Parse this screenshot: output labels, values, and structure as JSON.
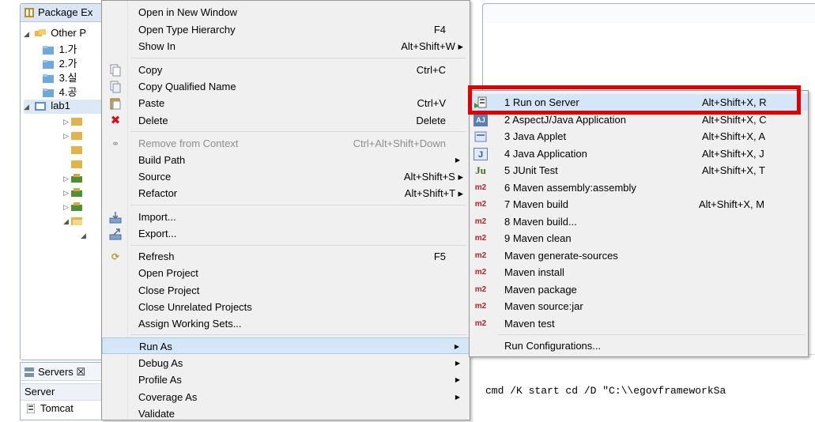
{
  "package_explorer": {
    "title": "Package Ex",
    "tree": [
      {
        "label": "Other P",
        "indent": 0
      },
      {
        "label": "1.가",
        "indent": 1
      },
      {
        "label": "2.가",
        "indent": 1
      },
      {
        "label": "3.실",
        "indent": 1
      },
      {
        "label": "4.공",
        "indent": 1
      },
      {
        "label": "lab1",
        "indent": 0
      }
    ]
  },
  "servers": {
    "title": "Servers",
    "tab_suffix": "☒",
    "column": "Server",
    "row": "Tomcat"
  },
  "context_menu": {
    "items": [
      {
        "label": "Open in New Window",
        "shortcut": ""
      },
      {
        "label": "Open Type Hierarchy",
        "shortcut": "F4"
      },
      {
        "label": "Show In",
        "shortcut": "Alt+Shift+W ▸"
      },
      {
        "label": "Copy",
        "shortcut": "Ctrl+C"
      },
      {
        "label": "Copy Qualified Name",
        "shortcut": ""
      },
      {
        "label": "Paste",
        "shortcut": "Ctrl+V"
      },
      {
        "label": "Delete",
        "shortcut": "Delete"
      },
      {
        "label": "Remove from Context",
        "shortcut": "Ctrl+Alt+Shift+Down"
      },
      {
        "label": "Build Path",
        "shortcut": ""
      },
      {
        "label": "Source",
        "shortcut": "Alt+Shift+S ▸"
      },
      {
        "label": "Refactor",
        "shortcut": "Alt+Shift+T ▸"
      },
      {
        "label": "Import...",
        "shortcut": ""
      },
      {
        "label": "Export...",
        "shortcut": ""
      },
      {
        "label": "Refresh",
        "shortcut": "F5"
      },
      {
        "label": "Open Project",
        "shortcut": ""
      },
      {
        "label": "Close Project",
        "shortcut": ""
      },
      {
        "label": "Close Unrelated Projects",
        "shortcut": ""
      },
      {
        "label": "Assign Working Sets...",
        "shortcut": ""
      },
      {
        "label": "Run As",
        "shortcut": ""
      },
      {
        "label": "Debug As",
        "shortcut": ""
      },
      {
        "label": "Profile As",
        "shortcut": ""
      },
      {
        "label": "Coverage As",
        "shortcut": ""
      },
      {
        "label": "Validate",
        "shortcut": ""
      }
    ]
  },
  "run_as_submenu": {
    "items": [
      {
        "icon": "",
        "label": "1 Run on Server",
        "shortcut": "Alt+Shift+X, R"
      },
      {
        "icon": "AJ",
        "label": "2 AspectJ/Java Application",
        "shortcut": "Alt+Shift+X, C"
      },
      {
        "icon": "",
        "label": "3 Java Applet",
        "shortcut": "Alt+Shift+X, A"
      },
      {
        "icon": "J",
        "label": "4 Java Application",
        "shortcut": "Alt+Shift+X, J"
      },
      {
        "icon": "Ju",
        "label": "5 JUnit Test",
        "shortcut": "Alt+Shift+X, T"
      },
      {
        "icon": "m2",
        "label": "6 Maven assembly:assembly",
        "shortcut": ""
      },
      {
        "icon": "m2",
        "label": "7 Maven build",
        "shortcut": "Alt+Shift+X, M"
      },
      {
        "icon": "m2",
        "label": "8 Maven build...",
        "shortcut": ""
      },
      {
        "icon": "m2",
        "label": "9 Maven clean",
        "shortcut": ""
      },
      {
        "icon": "m2",
        "label": "Maven generate-sources",
        "shortcut": ""
      },
      {
        "icon": "m2",
        "label": "Maven install",
        "shortcut": ""
      },
      {
        "icon": "m2",
        "label": "Maven package",
        "shortcut": ""
      },
      {
        "icon": "m2",
        "label": "Maven source:jar",
        "shortcut": ""
      },
      {
        "icon": "m2",
        "label": "Maven test",
        "shortcut": ""
      },
      {
        "icon": "",
        "label": "Run Configurations...",
        "shortcut": ""
      }
    ]
  },
  "console": {
    "line": "cmd /K start cd /D \"C:\\\\egovframeworkSa"
  },
  "colors": {
    "highlight_box": "#e00000",
    "menu_bg": "#f0f0f0",
    "selected_item": "#d5e6f9",
    "maven_icon": "#c0202a"
  }
}
